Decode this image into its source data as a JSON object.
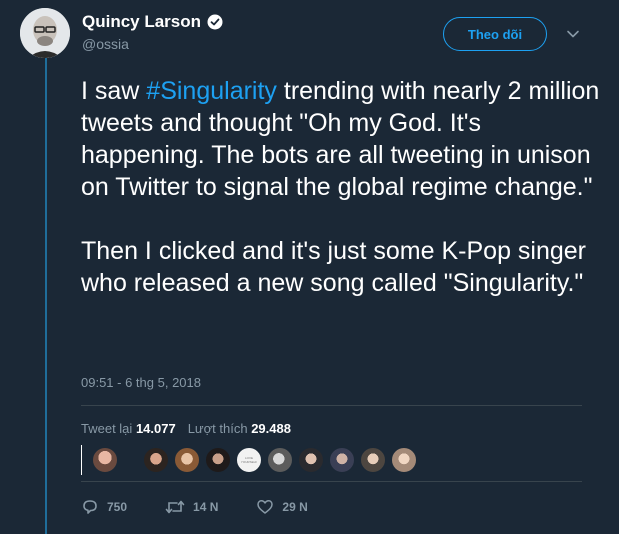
{
  "tweet": {
    "author": {
      "display_name": "Quincy Larson",
      "handle": "@ossia",
      "verified": true
    },
    "follow_label": "Theo dõi",
    "text_before": "I saw ",
    "hashtag": "#Singularity",
    "text_after": " trending with nearly 2 million tweets and thought \"Oh my God. It's happening. The bots are all tweeting in unison on Twitter to signal the global regime change.\"\n\nThen I clicked and it's just some K-Pop singer who released a new song called \"Singularity.\"",
    "timestamp": "09:51 - 6 thg 5, 2018",
    "stats": {
      "retweets_label": "Tweet lại",
      "retweets_value": "14.077",
      "likes_label": "Lượt thích",
      "likes_value": "29.488"
    },
    "liker_avatar_logo_text": "LOVE YOURSELF",
    "actions": {
      "reply_count": "750",
      "retweet_count": "14 N",
      "like_count": "29 N"
    }
  },
  "colors": {
    "background": "#1b2836",
    "accent": "#1da1f2",
    "muted": "#8899a6",
    "thread_line": "#1f6d9a"
  },
  "icons": [
    "verified-badge-icon",
    "chevron-down-icon",
    "reply-icon",
    "retweet-icon",
    "like-icon"
  ]
}
